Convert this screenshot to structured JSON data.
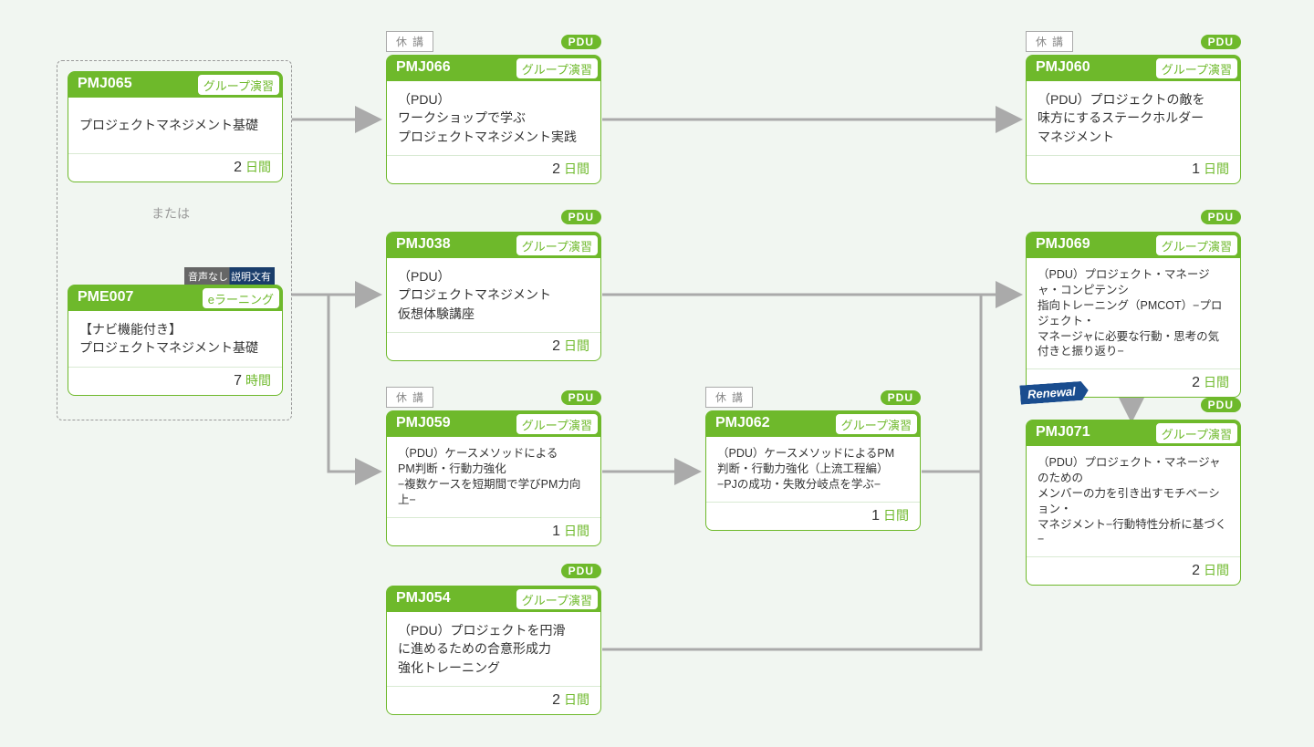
{
  "labels": {
    "or": "または",
    "kyuukou": "休講",
    "pdu": "PDU",
    "renewal": "Renewal",
    "audio_badge": "音声なし 説明文有"
  },
  "common": {
    "tag_group": "グループ演習",
    "tag_elearning": "eラーニング",
    "unit_days": "日間",
    "unit_hours": "時間"
  },
  "cards": {
    "pmj065": {
      "code": "PMJ065",
      "title": "プロジェクトマネジメント基礎",
      "duration": "2"
    },
    "pme007": {
      "code": "PME007",
      "title": "【ナビ機能付き】\nプロジェクトマネジメント基礎",
      "duration": "7"
    },
    "pmj066": {
      "code": "PMJ066",
      "title": "（PDU）\nワークショップで学ぶ\nプロジェクトマネジメント実践",
      "duration": "2"
    },
    "pmj038": {
      "code": "PMJ038",
      "title": "（PDU）\nプロジェクトマネジメント\n仮想体験講座",
      "duration": "2"
    },
    "pmj059": {
      "code": "PMJ059",
      "title": "（PDU）ケースメソッドによる\nPM判断・行動力強化\n−複数ケースを短期間で学びPM力向上−",
      "duration": "1"
    },
    "pmj054": {
      "code": "PMJ054",
      "title": "（PDU）プロジェクトを円滑\nに進めるための合意形成力\n強化トレーニング",
      "duration": "2"
    },
    "pmj062": {
      "code": "PMJ062",
      "title": "（PDU）ケースメソッドによるPM\n判断・行動力強化（上流工程編）\n−PJの成功・失敗分岐点を学ぶ−",
      "duration": "1"
    },
    "pmj060": {
      "code": "PMJ060",
      "title": "（PDU）プロジェクトの敵を\n味方にするステークホルダー\nマネジメント",
      "duration": "1"
    },
    "pmj069": {
      "code": "PMJ069",
      "title": "（PDU）プロジェクト・マネージャ・コンピテンシ\n指向トレーニング（PMCOT）−プロジェクト・\nマネージャに必要な行動・思考の気付きと振り返り−",
      "duration": "2"
    },
    "pmj071": {
      "code": "PMJ071",
      "title": "（PDU）プロジェクト・マネージャのための\nメンバーの力を引き出すモチベーション・\nマネジメント−行動特性分析に基づく−",
      "duration": "2"
    }
  }
}
